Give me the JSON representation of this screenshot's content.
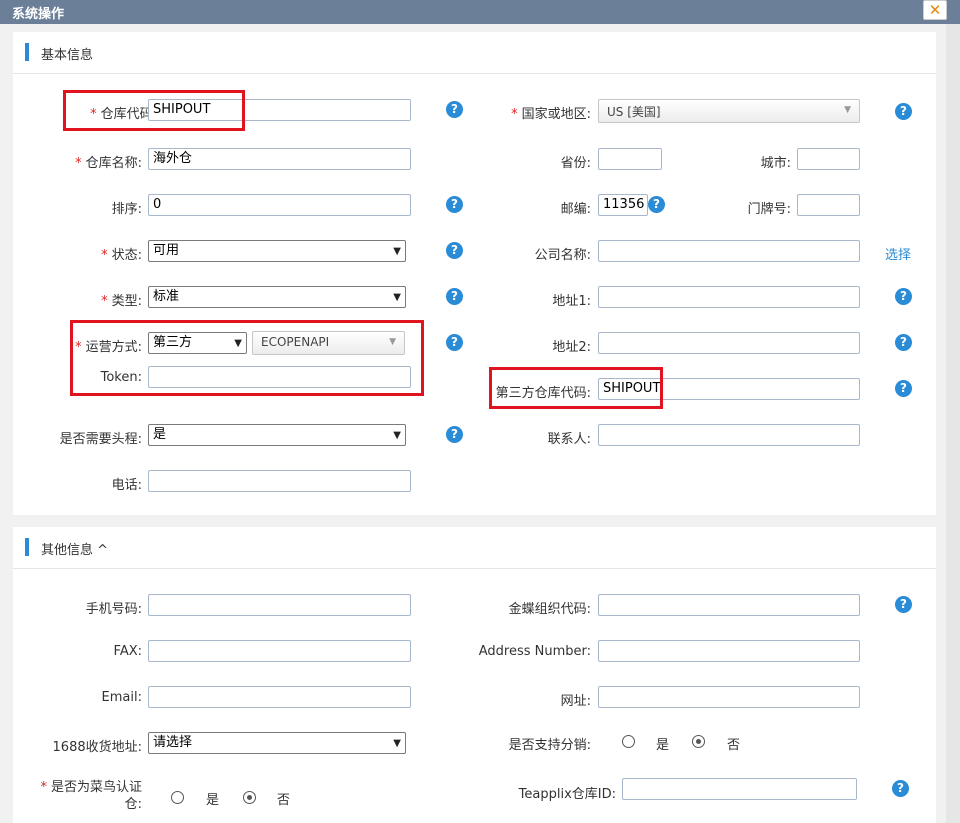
{
  "window": {
    "title": "系统操作",
    "close_icon": "close-icon"
  },
  "sections": {
    "basic": "基本信息",
    "other": "其他信息 ^"
  },
  "basic": {
    "warehouse_code": {
      "label": "仓库代码:",
      "value": "SHIPOUT"
    },
    "country": {
      "label": "国家或地区:",
      "value": "US [美国]"
    },
    "warehouse_name": {
      "label": "仓库名称:",
      "value": "海外仓"
    },
    "province": {
      "label": "省份:",
      "value": ""
    },
    "city": {
      "label": "城市:",
      "value": ""
    },
    "sort": {
      "label": "排序:",
      "value": "0"
    },
    "postcode": {
      "label": "邮编:",
      "value": "11356"
    },
    "house_no": {
      "label": "门牌号:",
      "value": ""
    },
    "status": {
      "label": "状态:",
      "value": "可用"
    },
    "company": {
      "label": "公司名称:",
      "value": "",
      "link": "选择"
    },
    "type": {
      "label": "类型:",
      "value": "标准"
    },
    "address1": {
      "label": "地址1:",
      "value": ""
    },
    "operation": {
      "label": "运营方式:",
      "value": "第三方",
      "api": "ECOPENAPI"
    },
    "address2": {
      "label": "地址2:",
      "value": ""
    },
    "token": {
      "label": "Token:",
      "value": ""
    },
    "third_code": {
      "label": "第三方仓库代码:",
      "value": "SHIPOUT"
    },
    "first_leg": {
      "label": "是否需要头程:",
      "value": "是"
    },
    "contact": {
      "label": "联系人:",
      "value": ""
    },
    "phone": {
      "label": "电话:",
      "value": ""
    }
  },
  "other": {
    "mobile": {
      "label": "手机号码:",
      "value": ""
    },
    "kingdee": {
      "label": "金蝶组织代码:",
      "value": ""
    },
    "fax": {
      "label": "FAX:",
      "value": ""
    },
    "address_number": {
      "label": "Address Number:",
      "value": ""
    },
    "email": {
      "label": "Email:",
      "value": ""
    },
    "website": {
      "label": "网址:",
      "value": ""
    },
    "addr1688": {
      "label": "1688收货地址:",
      "value": "请选择"
    },
    "distribution": {
      "label": "是否支持分销:",
      "yes": "是",
      "no": "否",
      "selected": "否"
    },
    "cainiao": {
      "label_line1": "是否为菜鸟认证",
      "label_line2": "仓:",
      "yes": "是",
      "no": "否",
      "selected": "否"
    },
    "teapplix": {
      "label": "Teapplix仓库ID:",
      "value": ""
    }
  },
  "icons": {
    "help": "help-icon",
    "required": "*"
  },
  "colors": {
    "titlebar": "#6b7f99",
    "accent": "#2b8ad8",
    "highlight": "#e0141e"
  }
}
